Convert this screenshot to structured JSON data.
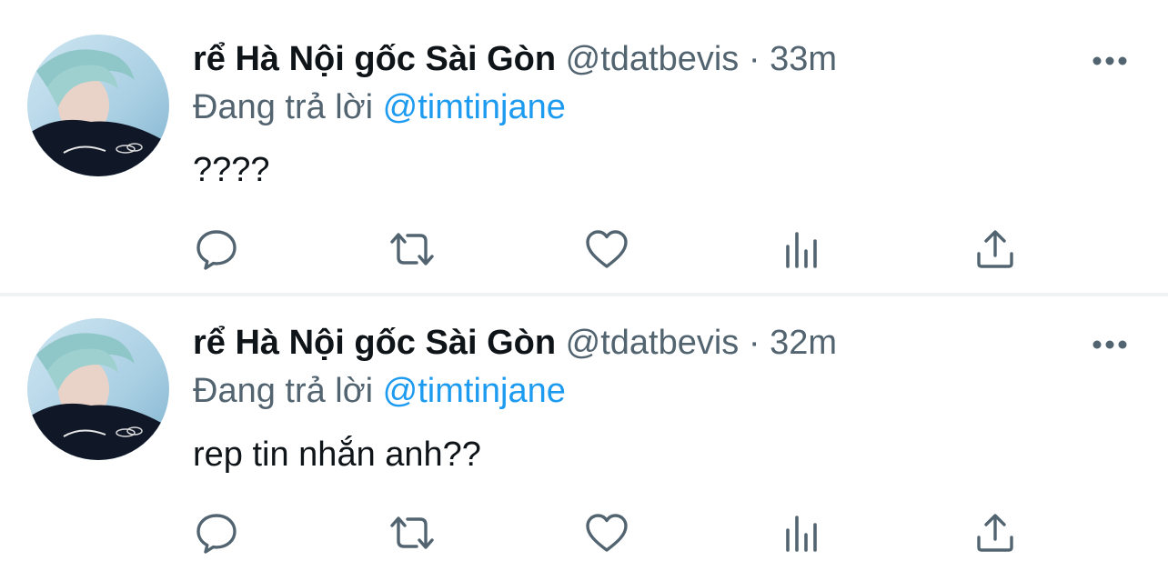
{
  "colors": {
    "text_primary": "#0f1419",
    "text_secondary": "#536471",
    "mention_blue": "#1d9bf0",
    "divider": "#eff3f4"
  },
  "tweets": [
    {
      "display_name": "rể Hà Nội gốc Sài Gòn",
      "handle": "@tdatbevis",
      "separator": "·",
      "time": "33m",
      "replying_prefix": "Đang trả lời",
      "replying_to": "@timtinjane",
      "text": "????",
      "actions": [
        "reply-icon",
        "retweet-icon",
        "like-icon",
        "analytics-icon",
        "share-icon"
      ]
    },
    {
      "display_name": "rể Hà Nội gốc Sài Gòn",
      "handle": "@tdatbevis",
      "separator": "·",
      "time": "32m",
      "replying_prefix": "Đang trả lời",
      "replying_to": "@timtinjane",
      "text": "rep tin nhắn anh??",
      "actions": [
        "reply-icon",
        "retweet-icon",
        "like-icon",
        "analytics-icon",
        "share-icon"
      ]
    }
  ]
}
